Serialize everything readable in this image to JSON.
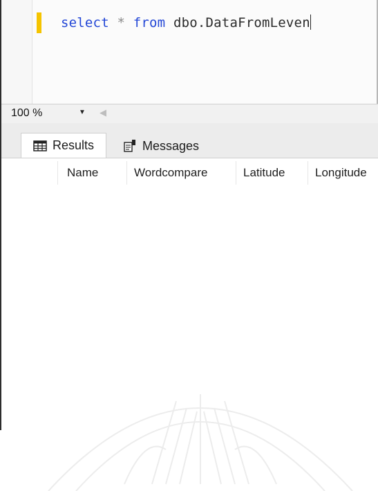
{
  "editor": {
    "query": {
      "keyword_select": "select",
      "operator_star": "*",
      "keyword_from": "from",
      "object_name": "dbo.DataFromLeven"
    }
  },
  "zoom": {
    "value": "100 %"
  },
  "tabs": [
    {
      "label": "Results",
      "icon": "grid-icon"
    },
    {
      "label": "Messages",
      "icon": "messages-icon"
    }
  ],
  "results_grid": {
    "columns": [
      "Name",
      "Wordcompare",
      "Latitude",
      "Longitude"
    ],
    "rows": []
  },
  "colors": {
    "keyword": "#2246d6",
    "change_marker": "#f5c400",
    "operator": "#8a8a8a"
  }
}
